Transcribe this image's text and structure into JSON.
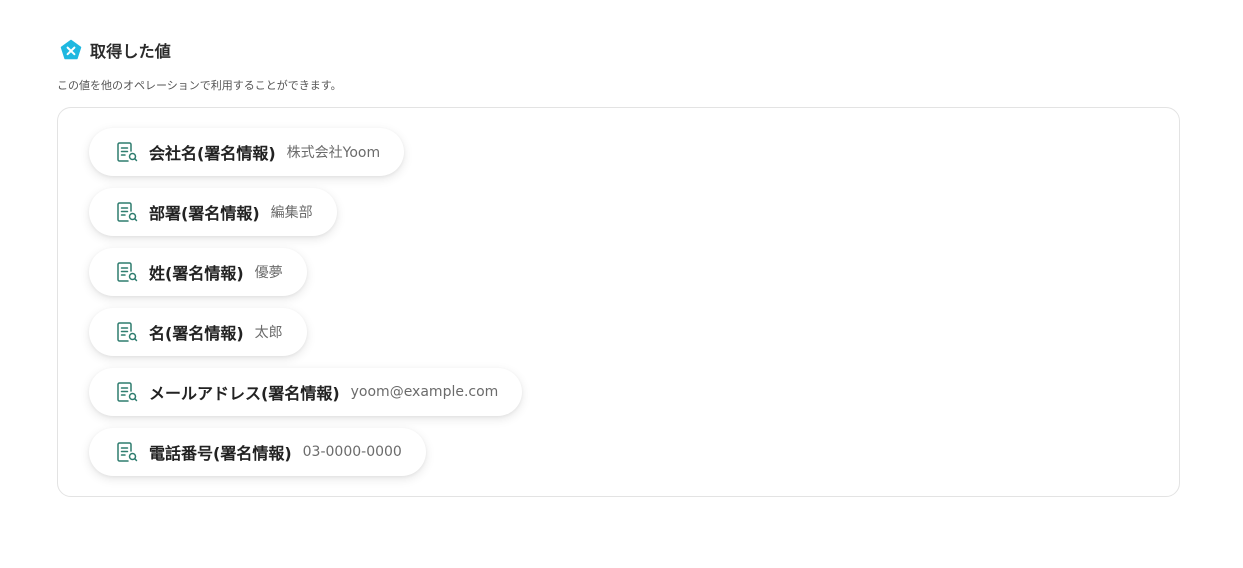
{
  "header": {
    "title": "取得した値",
    "badge_icon": "x-badge-icon",
    "badge_color": "#1fb8e0"
  },
  "subtitle": "この値を他のオペレーションで利用することができます。",
  "items": [
    {
      "label": "会社名(署名情報)",
      "value": "株式会社Yoom",
      "icon": "document-search-icon"
    },
    {
      "label": "部署(署名情報)",
      "value": "編集部",
      "icon": "document-search-icon"
    },
    {
      "label": "姓(署名情報)",
      "value": "優夢",
      "icon": "document-search-icon"
    },
    {
      "label": "名(署名情報)",
      "value": "太郎",
      "icon": "document-search-icon"
    },
    {
      "label": "メールアドレス(署名情報)",
      "value": "yoom@example.com",
      "icon": "document-search-icon"
    },
    {
      "label": "電話番号(署名情報)",
      "value": "03-0000-0000",
      "icon": "document-search-icon"
    }
  ],
  "colors": {
    "icon_stroke": "#2f7d6f",
    "panel_border": "#e3e3e3"
  }
}
